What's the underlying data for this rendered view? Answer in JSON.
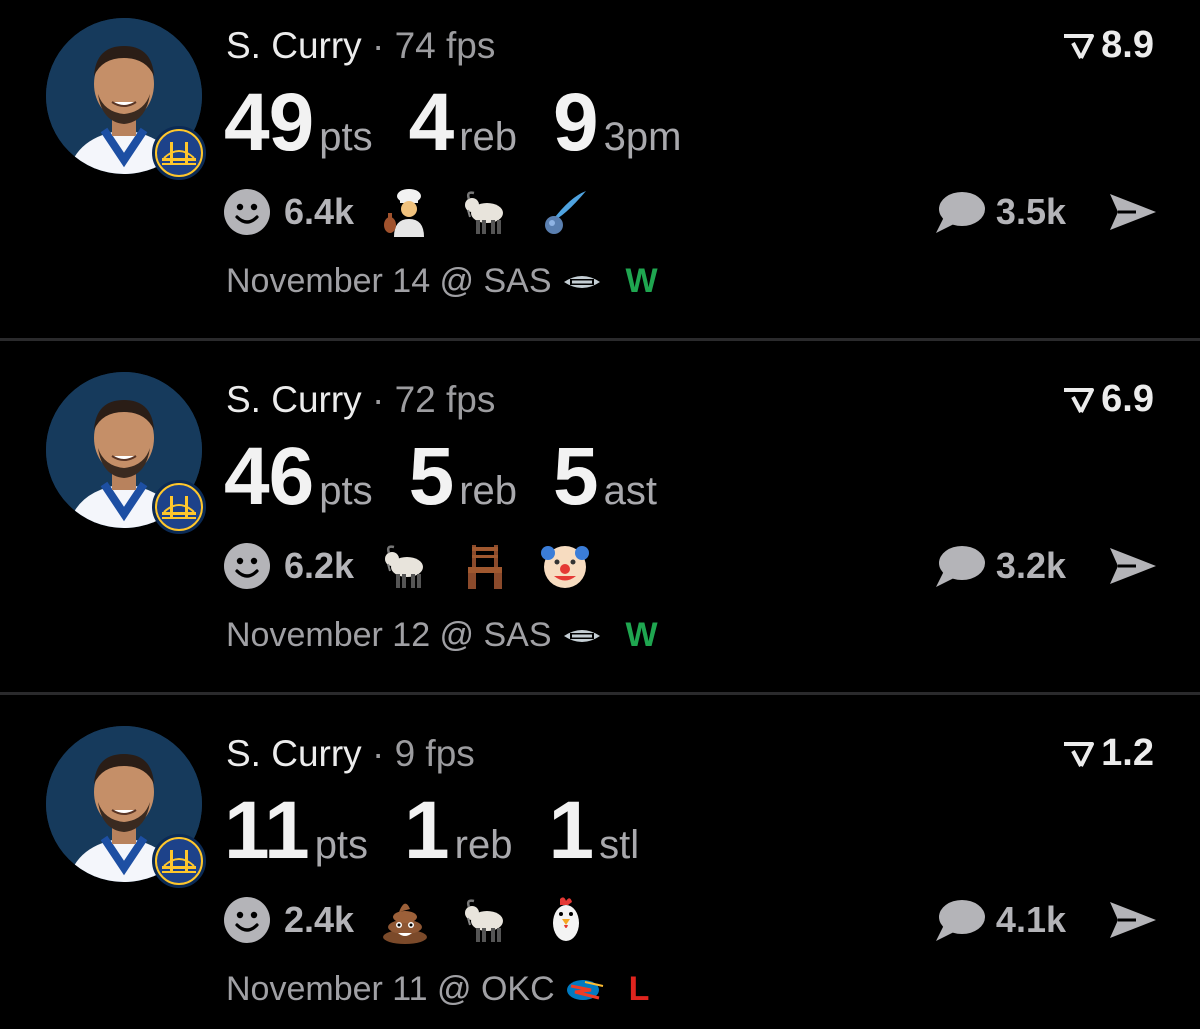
{
  "colors": {
    "background": "#000000",
    "win": "#1fa650",
    "loss": "#e0241e",
    "muted": "#9c9c9f",
    "divider": "#2a2a2c"
  },
  "posts": [
    {
      "player": "S. Curry",
      "separator": "·",
      "fps": "74 fps",
      "rating": "8.9",
      "stats": [
        {
          "value": "49",
          "label": "pts"
        },
        {
          "value": "4",
          "label": "reb"
        },
        {
          "value": "9",
          "label": "3pm"
        }
      ],
      "reaction_count": "6.4k",
      "emojis": [
        "cook-emoji",
        "goat-emoji",
        "comet-emoji"
      ],
      "comment_count": "3.5k",
      "game": "November 14 @ SAS",
      "opponent_logo": "spurs-logo-icon",
      "result": "W"
    },
    {
      "player": "S. Curry",
      "separator": "·",
      "fps": "72 fps",
      "rating": "6.9",
      "stats": [
        {
          "value": "46",
          "label": "pts"
        },
        {
          "value": "5",
          "label": "reb"
        },
        {
          "value": "5",
          "label": "ast"
        }
      ],
      "reaction_count": "6.2k",
      "emojis": [
        "goat-emoji",
        "chair-emoji",
        "clown-emoji"
      ],
      "comment_count": "3.2k",
      "game": "November 12 @ SAS",
      "opponent_logo": "spurs-logo-icon",
      "result": "W"
    },
    {
      "player": "S. Curry",
      "separator": "·",
      "fps": "9 fps",
      "rating": "1.2",
      "stats": [
        {
          "value": "11",
          "label": "pts"
        },
        {
          "value": "1",
          "label": "reb"
        },
        {
          "value": "1",
          "label": "stl"
        }
      ],
      "reaction_count": "2.4k",
      "emojis": [
        "poop-emoji",
        "goat-emoji",
        "chicken-emoji"
      ],
      "comment_count": "4.1k",
      "game": "November 11 @ OKC",
      "opponent_logo": "thunder-logo-icon",
      "result": "L"
    }
  ]
}
